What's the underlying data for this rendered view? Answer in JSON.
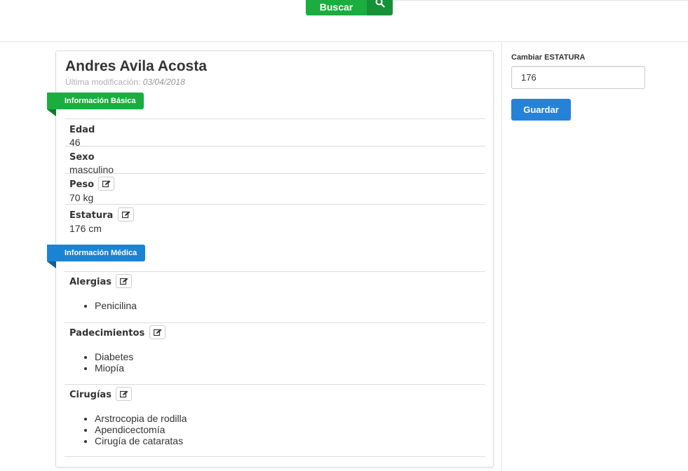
{
  "header": {
    "search_button_label": "Buscar",
    "search_icon": "search-icon"
  },
  "patient": {
    "name": "Andres Avila Acosta",
    "modified_label": "Última modificación:",
    "modified_date": "03/04/2018"
  },
  "basic_info": {
    "section_title": "Información Básica",
    "section_color": "#1aad3f",
    "fields": [
      {
        "label": "Edad",
        "value": "46"
      },
      {
        "label": "Sexo",
        "value": "masculino"
      },
      {
        "label": "Peso",
        "value": "70 kg"
      },
      {
        "label": "Estatura",
        "value": "176 cm"
      }
    ]
  },
  "medical_info": {
    "section_title": "Información Médica",
    "section_color": "#1a83d4",
    "allergies": {
      "label": "Alergias",
      "items": [
        "Penicilina"
      ]
    },
    "conditions": {
      "label": "Padecimientos",
      "items": [
        "Diabetes",
        "Miopía"
      ]
    },
    "surgeries": {
      "label": "Cirugías",
      "items": [
        "Arstrocopia de rodilla",
        "Apendicectomía",
        "Cirugía de cataratas"
      ]
    }
  },
  "sidebar": {
    "field_label": "Cambiar ESTATURA",
    "field_value": "176",
    "save_label": "Guardar",
    "save_color": "#2582d6"
  },
  "edit_icon": "edit-icon"
}
